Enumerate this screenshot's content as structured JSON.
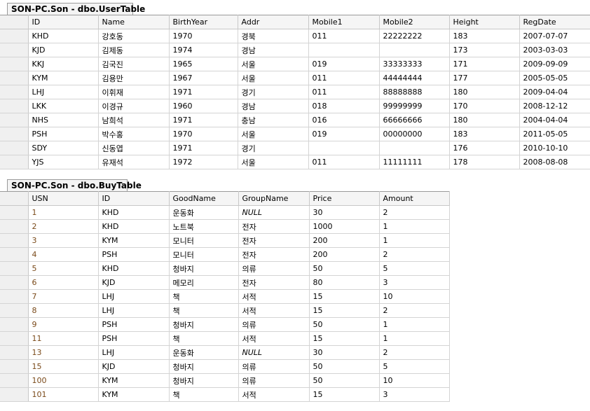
{
  "user_table": {
    "tab_title": "SON-PC.Son - dbo.UserTable",
    "columns": [
      "ID",
      "Name",
      "BirthYear",
      "Addr",
      "Mobile1",
      "Mobile2",
      "Height",
      "RegDate"
    ],
    "rows": [
      [
        "KHD",
        "강호동",
        "1970",
        "경북",
        "011",
        "22222222",
        "183",
        "2007-07-07"
      ],
      [
        "KJD",
        "김제동",
        "1974",
        "경남",
        "",
        "",
        "173",
        "2003-03-03"
      ],
      [
        "KKJ",
        "김국진",
        "1965",
        "서울",
        "019",
        "33333333",
        "171",
        "2009-09-09"
      ],
      [
        "KYM",
        "김용만",
        "1967",
        "서울",
        "011",
        "44444444",
        "177",
        "2005-05-05"
      ],
      [
        "LHJ",
        "이휘재",
        "1971",
        "경기",
        "011",
        "88888888",
        "180",
        "2009-04-04"
      ],
      [
        "LKK",
        "이경규",
        "1960",
        "경남",
        "018",
        "99999999",
        "170",
        "2008-12-12"
      ],
      [
        "NHS",
        "남희석",
        "1971",
        "충남",
        "016",
        "66666666",
        "180",
        "2004-04-04"
      ],
      [
        "PSH",
        "박수홍",
        "1970",
        "서울",
        "019",
        "00000000",
        "183",
        "2011-05-05"
      ],
      [
        "SDY",
        "신동엽",
        "1971",
        "경기",
        "",
        "",
        "176",
        "2010-10-10"
      ],
      [
        "YJS",
        "유재석",
        "1972",
        "서울",
        "011",
        "11111111",
        "178",
        "2008-08-08"
      ]
    ]
  },
  "buy_table": {
    "tab_title": "SON-PC.Son - dbo.BuyTable",
    "columns": [
      "USN",
      "ID",
      "GoodName",
      "GroupName",
      "Price",
      "Amount"
    ],
    "rows": [
      [
        "1",
        "KHD",
        "운동화",
        "NULL",
        "30",
        "2"
      ],
      [
        "2",
        "KHD",
        "노트북",
        "전자",
        "1000",
        "1"
      ],
      [
        "3",
        "KYM",
        "모니터",
        "전자",
        "200",
        "1"
      ],
      [
        "4",
        "PSH",
        "모니터",
        "전자",
        "200",
        "2"
      ],
      [
        "5",
        "KHD",
        "청바지",
        "의류",
        "50",
        "5"
      ],
      [
        "6",
        "KJD",
        "메모리",
        "전자",
        "80",
        "3"
      ],
      [
        "7",
        "LHJ",
        "책",
        "서적",
        "15",
        "10"
      ],
      [
        "8",
        "LHJ",
        "책",
        "서적",
        "15",
        "2"
      ],
      [
        "9",
        "PSH",
        "청바지",
        "의류",
        "50",
        "1"
      ],
      [
        "11",
        "PSH",
        "책",
        "서적",
        "15",
        "1"
      ],
      [
        "13",
        "LHJ",
        "운동화",
        "NULL",
        "30",
        "2"
      ],
      [
        "15",
        "KJD",
        "청바지",
        "의류",
        "50",
        "5"
      ],
      [
        "100",
        "KYM",
        "청바지",
        "의류",
        "50",
        "10"
      ],
      [
        "101",
        "KYM",
        "책",
        "서적",
        "15",
        "3"
      ]
    ]
  }
}
